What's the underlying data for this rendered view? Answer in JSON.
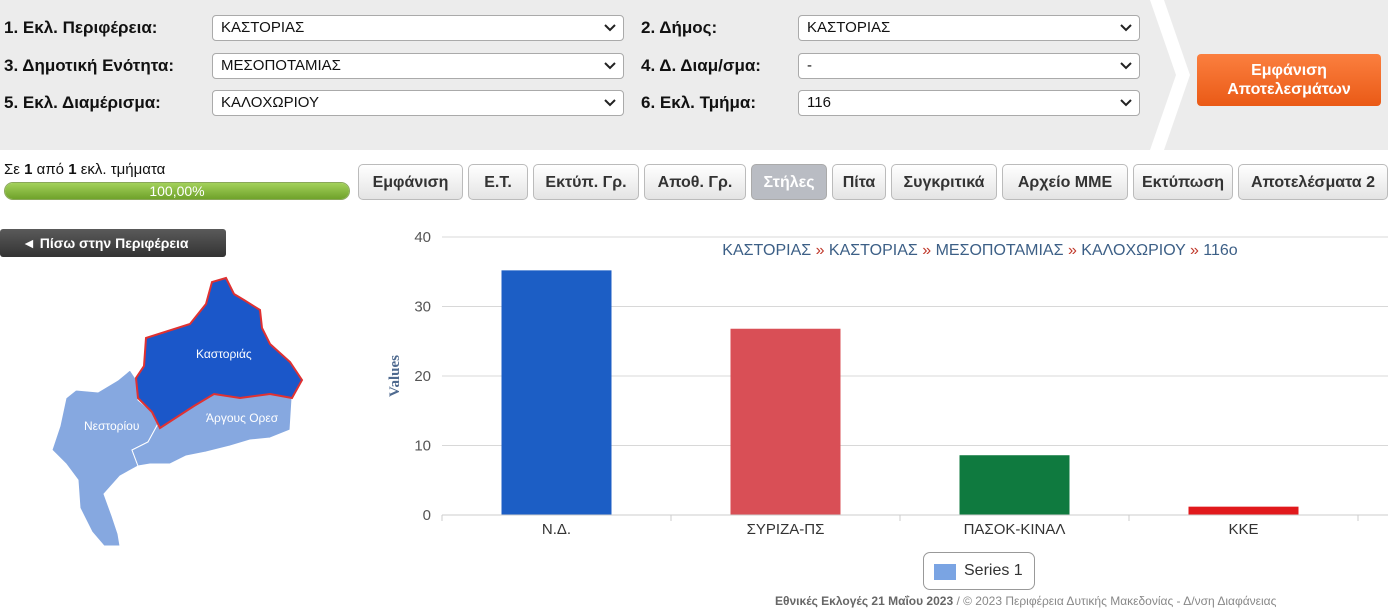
{
  "filters": [
    {
      "label": "1. Εκλ. Περιφέρεια:",
      "value": "ΚΑΣΤΟΡΙΑΣ"
    },
    {
      "label": "2. Δήμος:",
      "value": "ΚΑΣΤΟΡΙΑΣ"
    },
    {
      "label": "3. Δημοτική Ενότητα:",
      "value": "ΜΕΣΟΠΟΤΑΜΙΑΣ"
    },
    {
      "label": "4. Δ. Διαμ/σμα:",
      "value": "-"
    },
    {
      "label": "5. Εκλ. Διαμέρισμα:",
      "value": "ΚΑΛΟΧΩΡΙΟΥ"
    },
    {
      "label": "6. Εκλ. Τμήμα:",
      "value": "116"
    }
  ],
  "show_results_button": {
    "line1": "Εμφάνιση",
    "line2": "Αποτελεσμάτων"
  },
  "status": {
    "prefix": "Σε ",
    "count": "1",
    "middle": " από ",
    "total": "1",
    "suffix": " εκλ. τμήματα"
  },
  "progress": {
    "fraction": 1.0,
    "text": "100,00%"
  },
  "tabs": [
    {
      "label": "Εμφάνιση",
      "active": false
    },
    {
      "label": "Ε.Τ.",
      "active": false
    },
    {
      "label": "Εκτύπ. Γρ.",
      "active": false
    },
    {
      "label": "Αποθ. Γρ.",
      "active": false
    },
    {
      "label": "Στήλες",
      "active": true
    },
    {
      "label": "Πίτα",
      "active": false
    },
    {
      "label": "Συγκριτικά",
      "active": false
    },
    {
      "label": "Αρχείο ΜΜΕ",
      "active": false
    },
    {
      "label": "Εκτύπωση",
      "active": false
    },
    {
      "label": "Αποτελέσματα 2",
      "active": false
    }
  ],
  "back_button": "◄ Πίσω στην Περιφέρεια",
  "map": {
    "regions": [
      "Καστοριάς",
      "Νεστορίου",
      "Άργους Ορεσ"
    ]
  },
  "breadcrumb": {
    "parts": [
      "ΚΑΣΤΟΡΙΑΣ",
      "ΚΑΣΤΟΡΙΑΣ",
      "ΜΕΣΟΠΟΤΑΜΙΑΣ",
      "ΚΑΛΟΧΩΡΙΟΥ",
      "116ο"
    ],
    "sep": " » "
  },
  "chart_data": {
    "type": "bar",
    "categories": [
      "Ν.Δ.",
      "ΣΥΡΙΖΑ-ΠΣ",
      "ΠΑΣΟΚ-ΚΙΝΑΛ",
      "ΚΚΕ"
    ],
    "series": [
      {
        "name": "Series 1",
        "values": [
          35.2,
          26.8,
          8.6,
          1.2
        ]
      }
    ],
    "colors": [
      "#1c5ec5",
      "#d94f56",
      "#0f7a3f",
      "#e1191c"
    ],
    "legend_color": "#7aa4e3",
    "title": "",
    "xlabel": "",
    "ylabel": "Values",
    "ylim": [
      0,
      40
    ],
    "yticks": [
      0,
      10,
      20,
      30,
      40
    ],
    "grid": true,
    "legend": "bottom-center"
  },
  "footer": {
    "bold": "Εθνικές Εκλογές 21 Μαΐου 2023",
    "rest": " / © 2023 Περιφέρεια Δυτικής Μακεδονίας - Δ/νση Διαφάνειας"
  },
  "colors": {
    "accent_orange": "#ea5a16",
    "map_selected": "#1b57c9",
    "map_other": "#86a8e0",
    "progress_green": "#7fb133"
  }
}
